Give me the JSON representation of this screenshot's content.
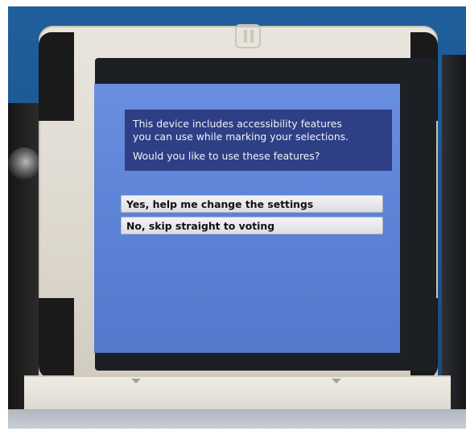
{
  "prompt": {
    "line1": "This device includes accessibility features",
    "line2": "you can use while marking your selections.",
    "question": "Would you like to use these features?"
  },
  "choices": {
    "yes_label": "Yes, help me change the settings",
    "no_label": "No, skip straight to voting"
  },
  "colors": {
    "screen_background": "#5f85d8",
    "prompt_panel": "#2f3f85",
    "button_face": "#e8e9ee",
    "device_frame": "#dcd7cd"
  },
  "icons": {
    "brand_logo": "bracket-logo-icon"
  }
}
